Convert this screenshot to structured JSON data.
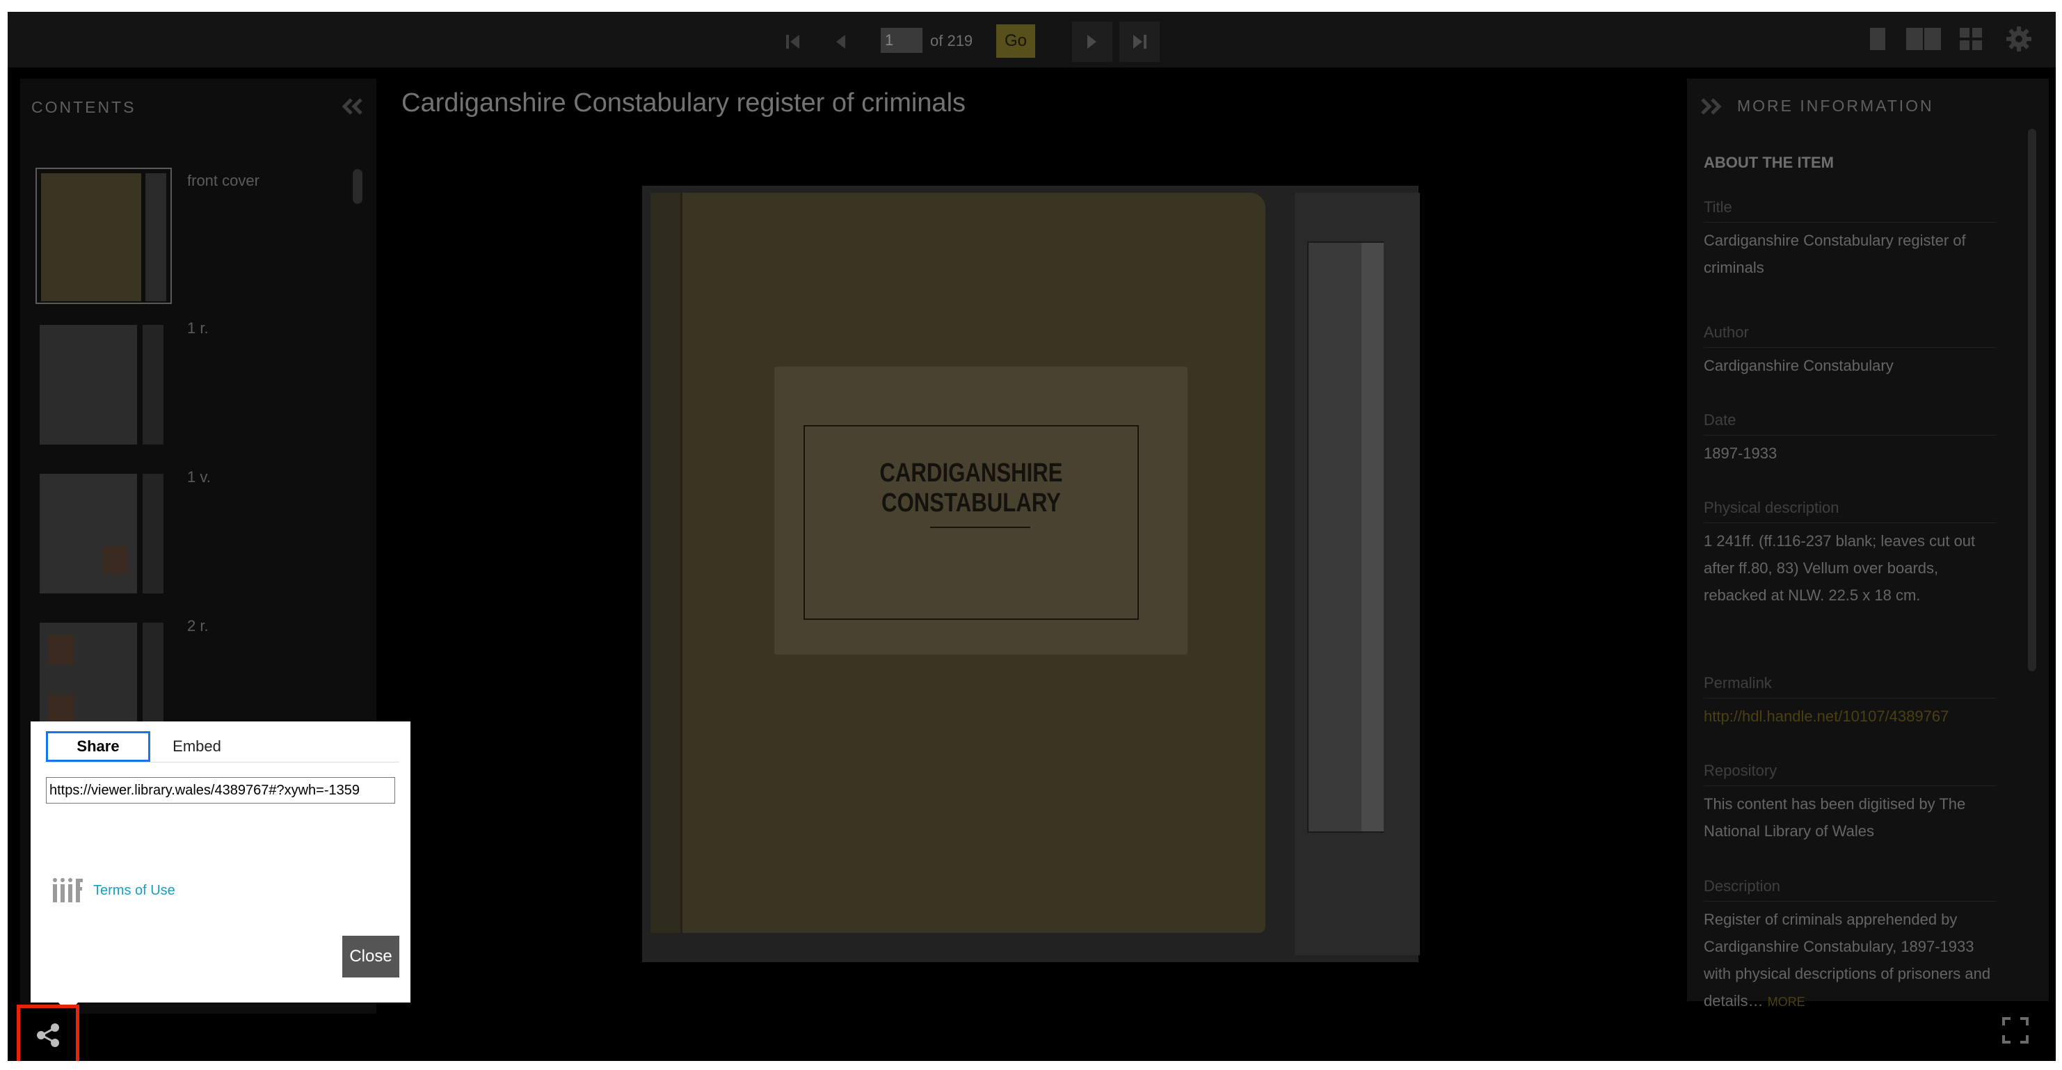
{
  "topbar": {
    "page_value": "1",
    "page_total": "of 219",
    "go_label": "Go"
  },
  "contents": {
    "title": "CONTENTS",
    "items": [
      {
        "label": "front cover"
      },
      {
        "label": "1 r."
      },
      {
        "label": "1 v."
      },
      {
        "label": "2 r."
      }
    ]
  },
  "main": {
    "title": "Cardiganshire Constabulary register of criminals",
    "cover_label": "CARDIGANSHIRE CONSTABULARY"
  },
  "info": {
    "title": "MORE INFORMATION",
    "about_heading": "ABOUT THE ITEM",
    "fields": [
      {
        "label": "Title",
        "value": "Cardiganshire Constabulary register of criminals"
      },
      {
        "label": "Author",
        "value": "Cardiganshire Constabulary"
      },
      {
        "label": "Date",
        "value": "1897-1933"
      },
      {
        "label": "Physical description",
        "value": "1 241ff. (ff.116-237 blank; leaves cut out after ff.80, 83) Vellum over boards, rebacked at NLW. 22.5 x 18 cm."
      },
      {
        "label": "Permalink",
        "value": "http://hdl.handle.net/10107/4389767"
      },
      {
        "label": "Repository",
        "value": "This content has been digitised by The National Library of Wales"
      },
      {
        "label": "Description",
        "value": "Register of criminals apprehended by Cardiganshire Constabulary, 1897-1933 with physical descriptions of prisoners and details…"
      }
    ],
    "more_label": "MORE"
  },
  "share_dialog": {
    "tab_share": "Share",
    "tab_embed": "Embed",
    "url": "https://viewer.library.wales/4389767#?xywh=-1359",
    "terms_label": "Terms of Use",
    "close_label": "Close"
  },
  "colors": {
    "highlight": "#e8230b",
    "go_button": "#57501a",
    "tab_focus": "#1a73e8",
    "terms_link": "#1a9ec0"
  }
}
